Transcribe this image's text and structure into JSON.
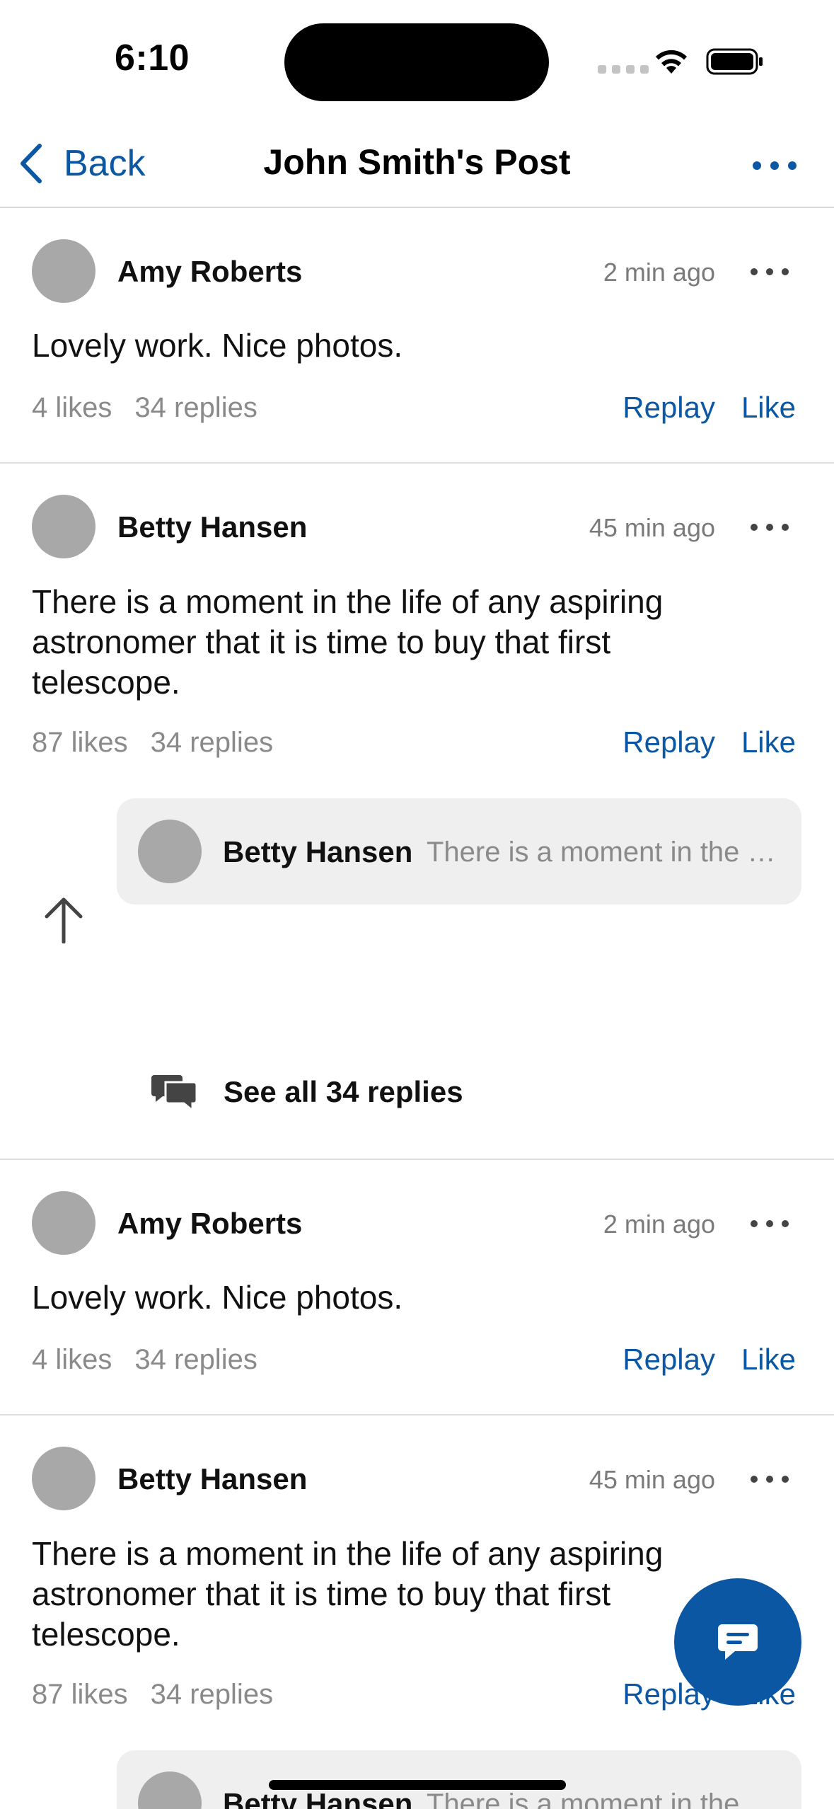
{
  "status_bar": {
    "time": "6:10"
  },
  "nav": {
    "back_label": "Back",
    "title": "John Smith's Post"
  },
  "comments": [
    {
      "author": "Amy Roberts",
      "time": "2 min ago",
      "text": "Lovely work. Nice photos.",
      "likes": "4 likes",
      "replies": "34 replies",
      "replay_label": "Replay",
      "like_label": "Like"
    },
    {
      "author": "Betty Hansen",
      "time": "45 min ago",
      "text": "There is a moment in the life of any aspiring astronomer that it is time to buy that first telescope.",
      "likes": "87 likes",
      "replies": "34 replies",
      "replay_label": "Replay",
      "like_label": "Like",
      "reply_preview": {
        "author": "Betty Hansen",
        "snippet": "There is a moment in the life of any aspiring astronomer"
      },
      "see_all_label": "See all 34 replies"
    },
    {
      "author": "Amy Roberts",
      "time": "2 min ago",
      "text": "Lovely work. Nice photos.",
      "likes": "4 likes",
      "replies": "34 replies",
      "replay_label": "Replay",
      "like_label": "Like"
    },
    {
      "author": "Betty Hansen",
      "time": "45 min ago",
      "text": "There is a moment in the life of any aspiring astronomer that it is time to buy that first telescope.",
      "likes": "87 likes",
      "replies": "34 replies",
      "replay_label": "Replay",
      "like_label": "Like",
      "reply_preview": {
        "author": "Betty Hansen",
        "snippet": "There is a moment in the life of any aspiring astronomer"
      }
    }
  ],
  "fab": {
    "icon": "chat-bubble-icon"
  },
  "colors": {
    "accent": "#0b57a4",
    "avatar": "#a8a8a8",
    "muted": "#8a8a8a",
    "preview_bg": "#efefef"
  }
}
